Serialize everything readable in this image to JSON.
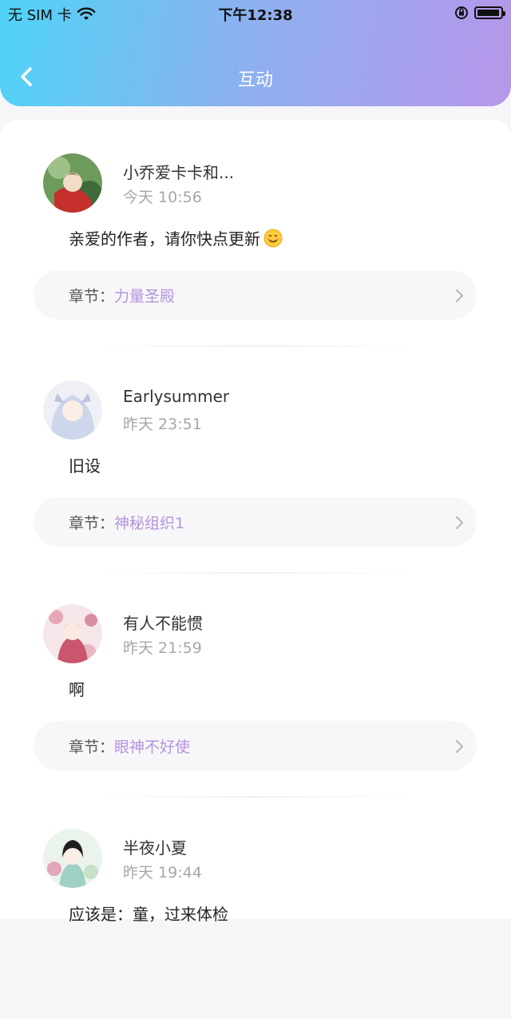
{
  "status_bar": {
    "carrier": "无 SIM 卡",
    "time": "下午12:38",
    "battery_level": 0.95
  },
  "header": {
    "title": "互动"
  },
  "comments": [
    {
      "name": "小乔爱卡卡和...",
      "time": "今天 10:56",
      "content": "亲爱的作者，请你快点更新",
      "emoji": "smiling-face-icon",
      "chapter_label": "章节：",
      "chapter_name": "力量圣殿"
    },
    {
      "name": "Earlysummer",
      "time": "昨天 23:51",
      "content": "旧设",
      "chapter_label": "章节：",
      "chapter_name": "神秘组织1"
    },
    {
      "name": "有人不能惯",
      "time": "昨天 21:59",
      "content": "啊",
      "chapter_label": "章节：",
      "chapter_name": "眼神不好使"
    },
    {
      "name": "半夜小夏",
      "time": "昨天 19:44",
      "content": "应该是：童，过来体检"
    }
  ],
  "colors": {
    "header_gradient": [
      "#4fd3f7",
      "#b796ea"
    ],
    "chapter_accent": "#b493dd"
  }
}
